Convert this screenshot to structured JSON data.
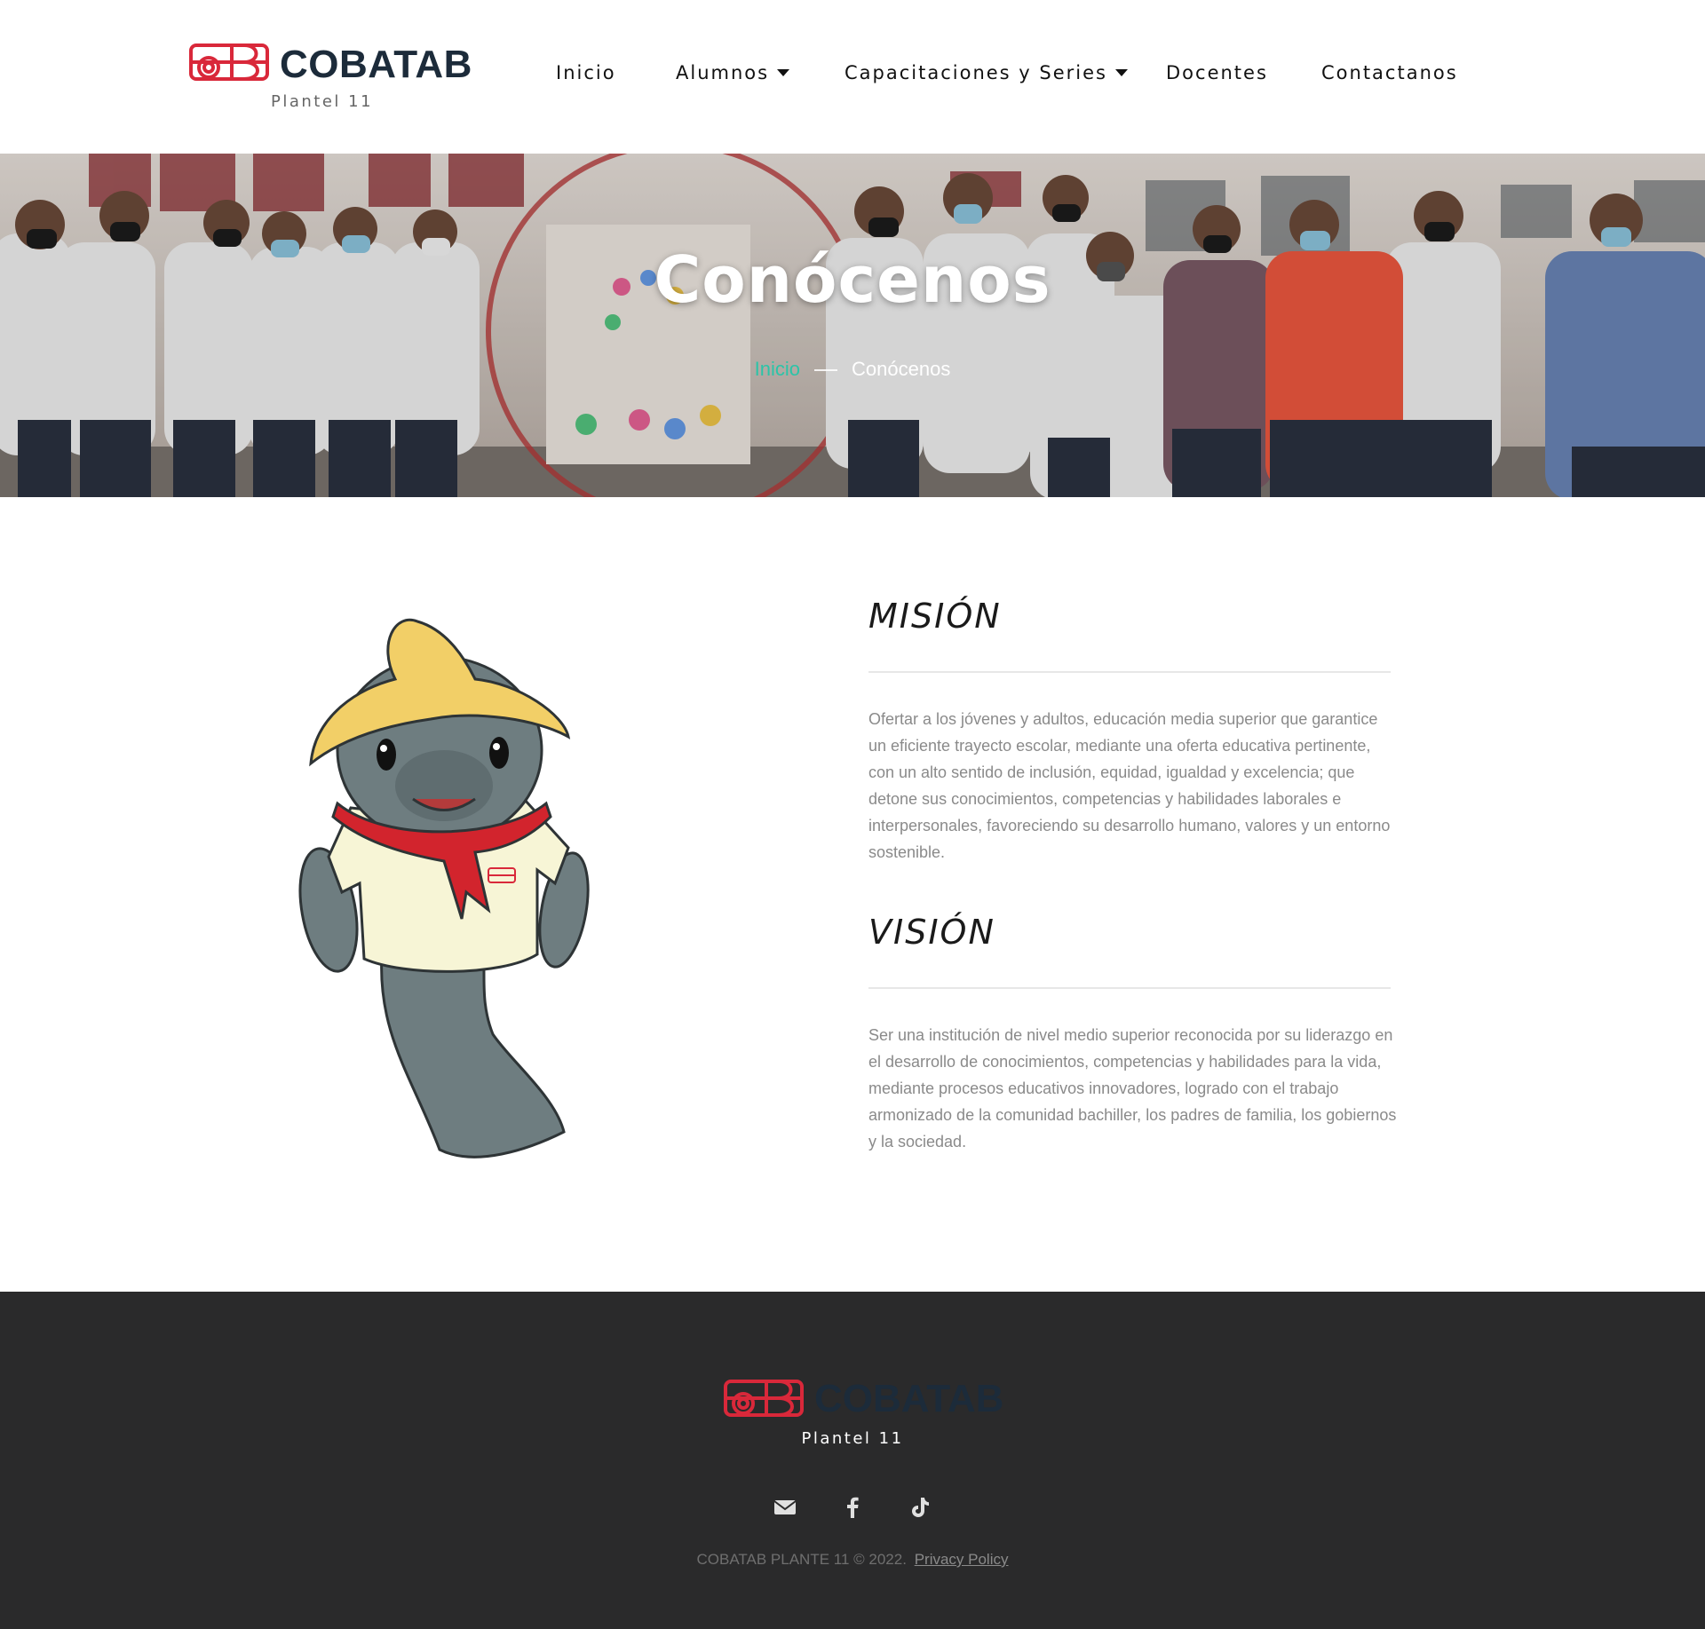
{
  "brand": {
    "name": "COBATAB",
    "subtitle": "Plantel 11",
    "accent_red": "#d9283a",
    "dark": "#1c2b3a"
  },
  "nav": {
    "items": [
      {
        "label": "Inicio",
        "dropdown": false
      },
      {
        "label": "Alumnos",
        "dropdown": true
      },
      {
        "label": "Capacitaciones y Series",
        "dropdown": true
      },
      {
        "label": "Docentes",
        "dropdown": false
      },
      {
        "label": "Contactanos",
        "dropdown": false
      }
    ]
  },
  "hero": {
    "title": "Conócenos",
    "breadcrumb_home": "Inicio",
    "breadcrumb_current": "Conócenos",
    "breadcrumb_link_color": "#2bc4a8"
  },
  "mission": {
    "heading": "MISIÓN",
    "text": "Ofertar a los jóvenes y adultos, educación media superior que garantice un eficiente trayecto escolar, mediante una oferta educativa pertinente, con un alto sentido de inclusión, equidad, igualdad y excelencia; que detone sus conocimientos, competencias y habilidades laborales e interpersonales, favoreciendo su desarrollo humano, valores y un entorno sostenible."
  },
  "vision": {
    "heading": "VISIÓN",
    "text": "Ser una institución de nivel medio superior reconocida por su liderazgo en el desarrollo de conocimientos, competencias y habilidades para la vida, mediante procesos educativos innovadores, logrado con el trabajo armonizado de la comunidad bachiller, los padres de familia, los gobiernos y la sociedad."
  },
  "footer": {
    "brand": "COBATAB",
    "subtitle": "Plantel 11",
    "social_icons": [
      "envelope-icon",
      "facebook-icon",
      "tiktok-icon"
    ],
    "copyright": "COBATAB PLANTE 11 ©  2022.",
    "privacy_label": "Privacy Policy",
    "background": "#2a2a2b"
  }
}
